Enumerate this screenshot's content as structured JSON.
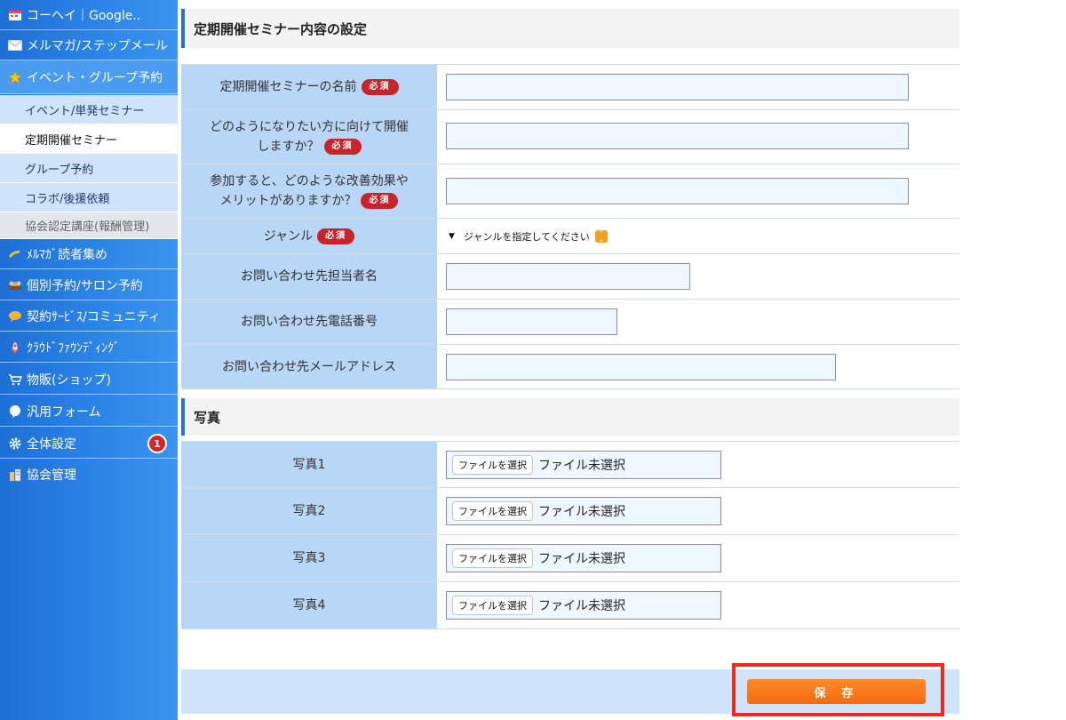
{
  "sidebar": {
    "items": [
      {
        "label": "コーヘイ｜Google..",
        "icon": "calendar-icon"
      },
      {
        "label": "メルマガ/ステップメール",
        "icon": "mail-icon"
      },
      {
        "label": "イベント・グループ予約",
        "icon": "star-icon"
      },
      {
        "label": "ﾒﾙﾏｶﾞ読者集め",
        "icon": "megaphone-icon"
      },
      {
        "label": "個別予約/サロン予約",
        "icon": "people-icon"
      },
      {
        "label": "契約ｻｰﾋﾞｽ/コミュニティ",
        "icon": "speech-icon"
      },
      {
        "label": "ｸﾗｳﾄﾞﾌｧｳﾝﾃﾞｨﾝｸﾞ",
        "icon": "rocket-icon"
      },
      {
        "label": "物販(ショップ)",
        "icon": "cart-icon"
      },
      {
        "label": "汎用フォーム",
        "icon": "bubble-icon"
      },
      {
        "label": "全体設定",
        "icon": "gear-icon",
        "badge": "1"
      },
      {
        "label": "協会管理",
        "icon": "building-icon"
      }
    ],
    "subitems": [
      {
        "label": "イベント/単発セミナー",
        "state": "normal"
      },
      {
        "label": "定期開催セミナー",
        "state": "active"
      },
      {
        "label": "グループ予約",
        "state": "normal"
      },
      {
        "label": "コラボ/後援依頼",
        "state": "normal"
      },
      {
        "label": "協会認定講座(報酬管理)",
        "state": "disabled"
      }
    ]
  },
  "sections": {
    "content_title": "定期開催セミナー内容の設定",
    "photo_title": "写真"
  },
  "required_label": "必須",
  "form": {
    "name_label": "定期開催セミナーの名前",
    "target_label_1": "どのようになりたい方に向けて開催",
    "target_label_2": "しますか？",
    "benefit_label_1": "参加すると、どのような改善効果や",
    "benefit_label_2": "メリットがありますか？",
    "genre_label": "ジャンル",
    "genre_selected": "ジャンルを指定してください",
    "contact_name_label": "お問い合わせ先担当者名",
    "contact_phone_label": "お問い合わせ先電話番号",
    "contact_email_label": "お問い合わせ先メールアドレス"
  },
  "photos": [
    {
      "label": "写真1"
    },
    {
      "label": "写真2"
    },
    {
      "label": "写真3"
    },
    {
      "label": "写真4"
    }
  ],
  "file_button_label": "ファイルを選択",
  "file_status": "ファイル未選択",
  "save_label": "保存",
  "colors": {
    "sidebar": "#2e86e8",
    "label_cell": "#b8d6f6",
    "required": "#c7252a",
    "save": "#f26a0f",
    "highlight": "#ee2a1c"
  }
}
